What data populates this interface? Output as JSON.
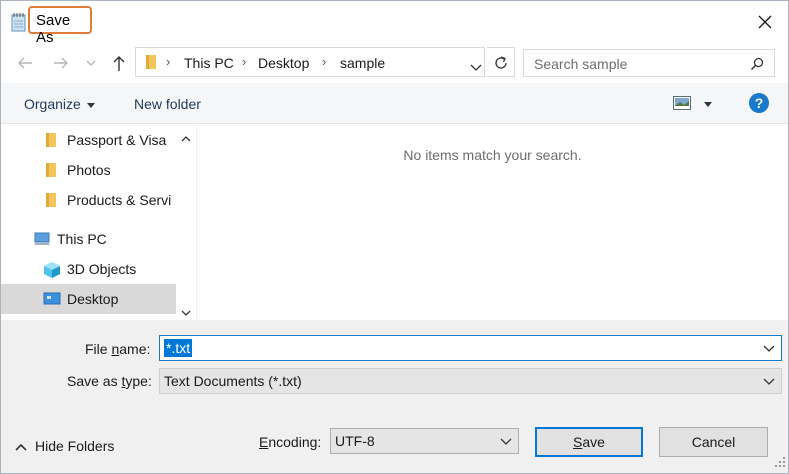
{
  "window": {
    "title": "Save As",
    "close_icon": "close-icon"
  },
  "address": {
    "breadcrumbs": [
      "This PC",
      "Desktop",
      "sample"
    ],
    "search_placeholder": "Search sample"
  },
  "toolbar": {
    "organize_label": "Organize",
    "new_folder_label": "New folder",
    "help_label": "?"
  },
  "navpane": {
    "items": [
      {
        "label": "Passport & Visa",
        "icon": "folder-icon"
      },
      {
        "label": "Photos",
        "icon": "folder-icon"
      },
      {
        "label": "Products & Servi",
        "icon": "folder-icon"
      },
      {
        "label": "This PC",
        "icon": "computer-icon"
      },
      {
        "label": "3D Objects",
        "icon": "3d-objects-icon"
      },
      {
        "label": "Desktop",
        "icon": "desktop-icon",
        "selected": true
      }
    ]
  },
  "filelist": {
    "empty_message": "No items match your search."
  },
  "form": {
    "file_name_label_pre": "File ",
    "file_name_label_u": "n",
    "file_name_label_post": "ame:",
    "file_name_value": "*.txt",
    "save_type_label_pre": "Save as ",
    "save_type_label_u": "t",
    "save_type_label_post": "ype:",
    "save_type_value": "Text Documents (*.txt)",
    "hide_folders_label": "Hide Folders",
    "encoding_label_pre": "",
    "encoding_label_u": "E",
    "encoding_label_post": "ncoding:",
    "encoding_value": "UTF-8",
    "save_button_u": "S",
    "save_button_post": "ave",
    "cancel_button": "Cancel"
  },
  "colors": {
    "accent": "#0078d7",
    "title_highlight": "#e07b39",
    "folder": "#f2c55c"
  }
}
